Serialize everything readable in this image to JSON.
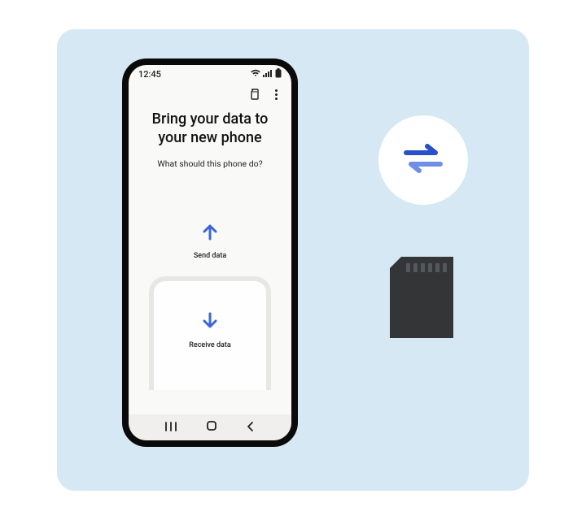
{
  "status": {
    "time": "12:45"
  },
  "screen": {
    "title_l1": "Bring your data to",
    "title_l2": "your new phone",
    "subtitle": "What should this phone do?",
    "send_label": "Send data",
    "receive_label": "Receive data"
  },
  "colors": {
    "accent": "#3b67d6",
    "panel_bg": "#d6e8f3",
    "sd_dark": "#333536"
  }
}
